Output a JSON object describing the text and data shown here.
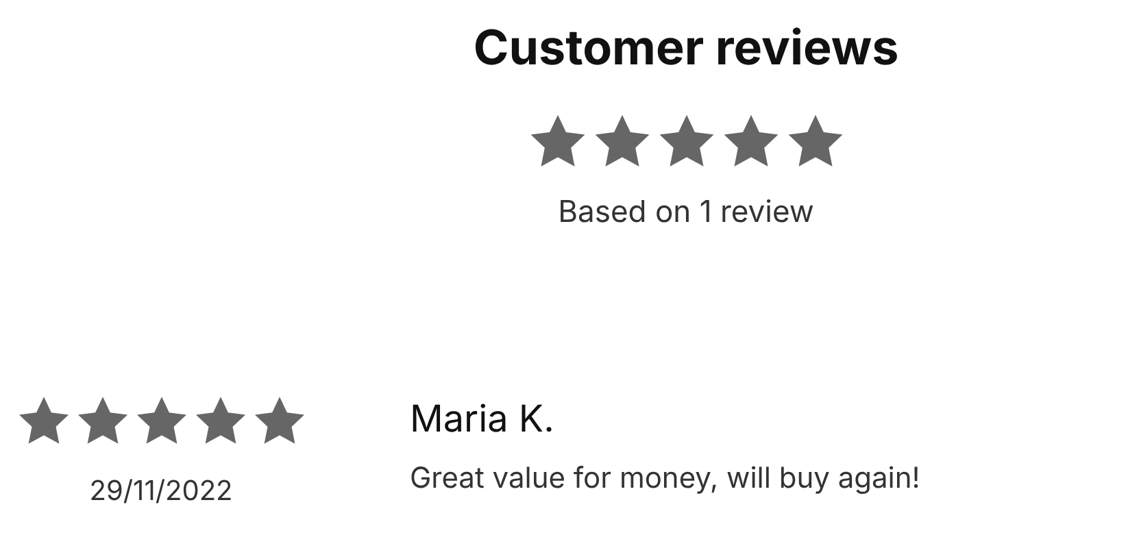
{
  "summary": {
    "title": "Customer reviews",
    "stars": 5,
    "caption": "Based on 1 review"
  },
  "reviews": [
    {
      "stars": 5,
      "date": "29/11/2022",
      "author": "Maria K.",
      "text": "Great value for money, will buy again!"
    }
  ]
}
